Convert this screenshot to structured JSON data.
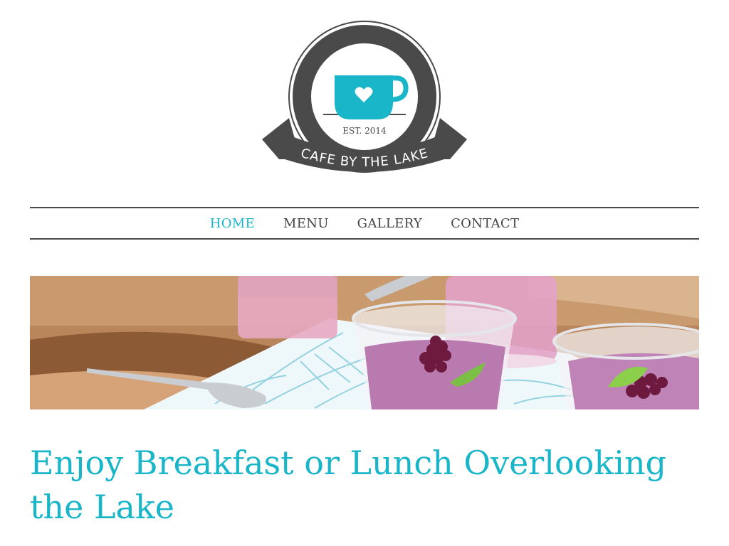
{
  "colors": {
    "accent": "#19b5c9",
    "dark": "#4a4a4a",
    "nav_text": "#444444"
  },
  "logo": {
    "name": "CAFE BY THE LAKE",
    "established": "EST. 2014",
    "icon": "coffee-cup-heart-icon"
  },
  "nav": {
    "items": [
      {
        "label": "HOME",
        "active": true
      },
      {
        "label": "MENU",
        "active": false
      },
      {
        "label": "GALLERY",
        "active": false
      },
      {
        "label": "CONTACT",
        "active": false
      }
    ]
  },
  "hero": {
    "image": "smoothie-glasses-with-blackberries-photo"
  },
  "main": {
    "headline": "Enjoy Breakfast or Lunch Overlooking the Lake"
  }
}
